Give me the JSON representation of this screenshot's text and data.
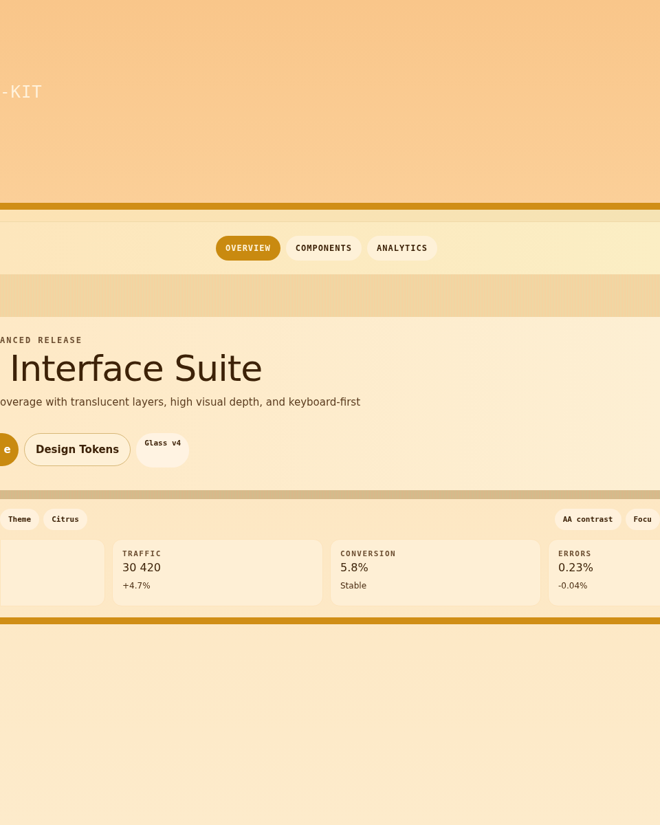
{
  "brand": {
    "wordmark": "-KIT"
  },
  "nav": {
    "tabs": [
      {
        "label": "OVERVIEW",
        "selected": true
      },
      {
        "label": "COMPONENTS",
        "selected": false
      },
      {
        "label": "ANALYTICS",
        "selected": false
      }
    ]
  },
  "hero": {
    "eyebrow": "ANCED RELEASE",
    "title": "Interface Suite",
    "subtitle": "overage with translucent layers, high visual depth, and keyboard-first",
    "actions": [
      {
        "kind": "primary",
        "label": "e"
      },
      {
        "kind": "outline",
        "label": "Design Tokens"
      },
      {
        "kind": "chip",
        "label": "Glass v4"
      }
    ]
  },
  "tags_left": [
    "Theme",
    "Citrus"
  ],
  "tags_right": [
    "AA contrast",
    "Focu"
  ],
  "stats": [
    {
      "kind": "blank"
    },
    {
      "kind": "metric",
      "label": "TRAFFIC",
      "value": "30 420",
      "delta": "+4.7%"
    },
    {
      "kind": "metric",
      "label": "CONVERSION",
      "value": "5.8%",
      "delta": "Stable"
    },
    {
      "kind": "metric",
      "label": "ERRORS",
      "value": "0.23%",
      "delta": "-0.04%"
    }
  ]
}
